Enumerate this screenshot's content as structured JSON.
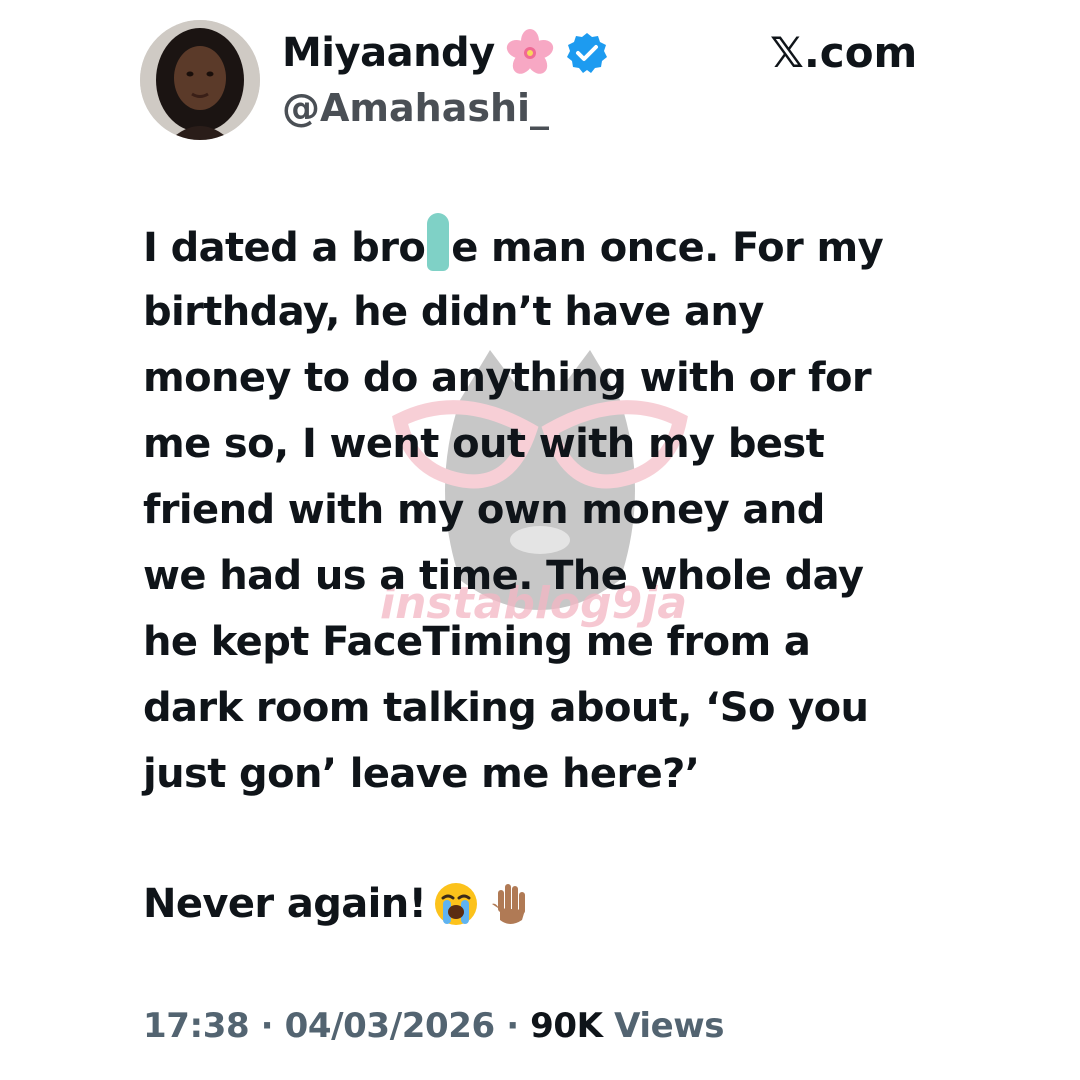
{
  "header": {
    "display_name": "Miyaandy",
    "handle": "@Amahashi_",
    "source": "𝕏.com"
  },
  "tweet": {
    "lines": [
      [
        "I dated a bro",
        "e man once. For my"
      ],
      "birthday, he didn’t have any",
      "money to do anything with or for",
      "me so, I went out with my best",
      "friend with my own money and",
      "we had us a time. The whole day",
      "he kept FaceTiming me from a",
      "dark room talking about, ‘So you",
      "just gon’ leave me here?’"
    ],
    "closing": "Never again!"
  },
  "meta": {
    "time": "17:38",
    "separator": "·",
    "date": "04/03/2026",
    "views_count": "90K",
    "views_label": "Views"
  },
  "watermark": {
    "text": "instablog9ja"
  },
  "colors": {
    "verified": "#1d9bf0",
    "text": "#0f1419",
    "muted": "#536471",
    "censor": "#7fd1c6",
    "watermark_pink": "#f3b6c3"
  },
  "icons": {
    "flower": "cherry-blossom-icon",
    "verified": "verified-badge-icon",
    "emoji_1": "loudly-crying-face-icon",
    "emoji_2": "raised-hand-icon"
  }
}
